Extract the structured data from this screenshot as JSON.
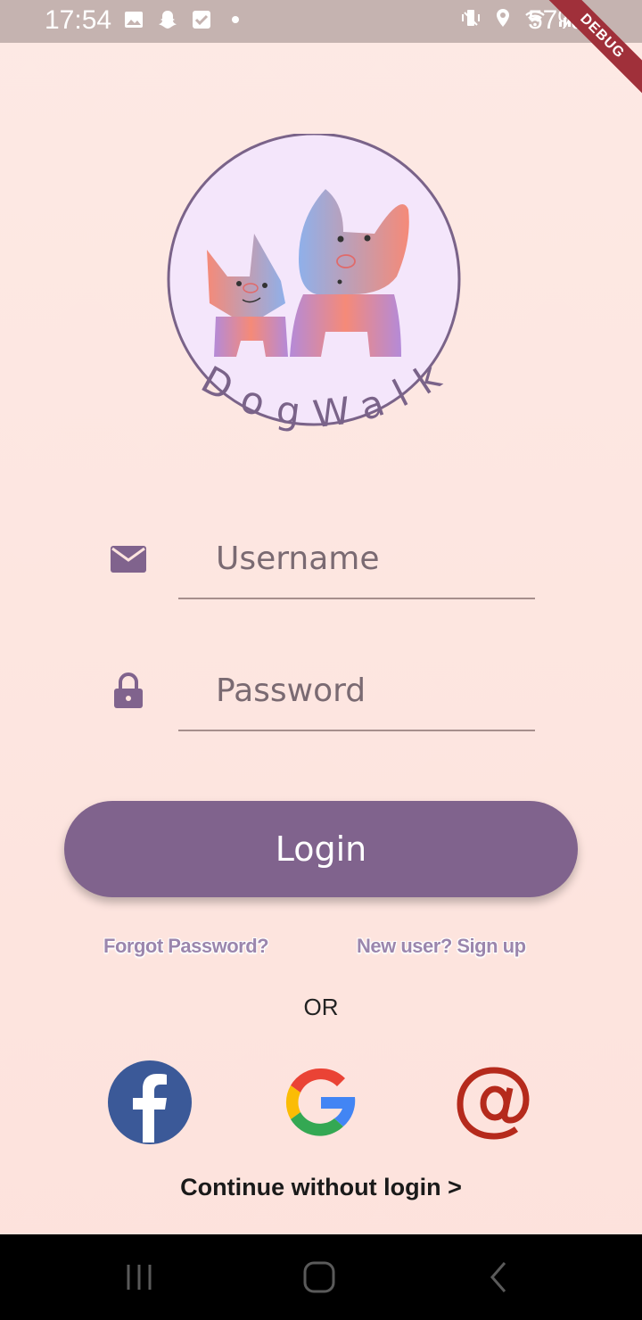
{
  "status_bar": {
    "time": "17:54",
    "battery": "57%",
    "left_icons": [
      "image-icon",
      "snapchat-icon",
      "check-icon",
      "dot-icon"
    ],
    "right_icons": [
      "vibrate-icon",
      "location-icon",
      "wifi-icon",
      "signal-icon"
    ],
    "debug_label": "DEBUG"
  },
  "logo": {
    "text": "DogWalk"
  },
  "form": {
    "username_placeholder": "Username",
    "password_placeholder": "Password",
    "login_label": "Login"
  },
  "links": {
    "forgot_password": "Forgot Password?",
    "signup": "New user? Sign up",
    "or": "OR",
    "continue": "Continue without login >"
  },
  "social": [
    "facebook-icon",
    "google-icon",
    "email-icon"
  ],
  "colors": {
    "accent": "#80638d",
    "background": "#fde4de",
    "facebook": "#3b5998",
    "email": "#b52a1c"
  }
}
